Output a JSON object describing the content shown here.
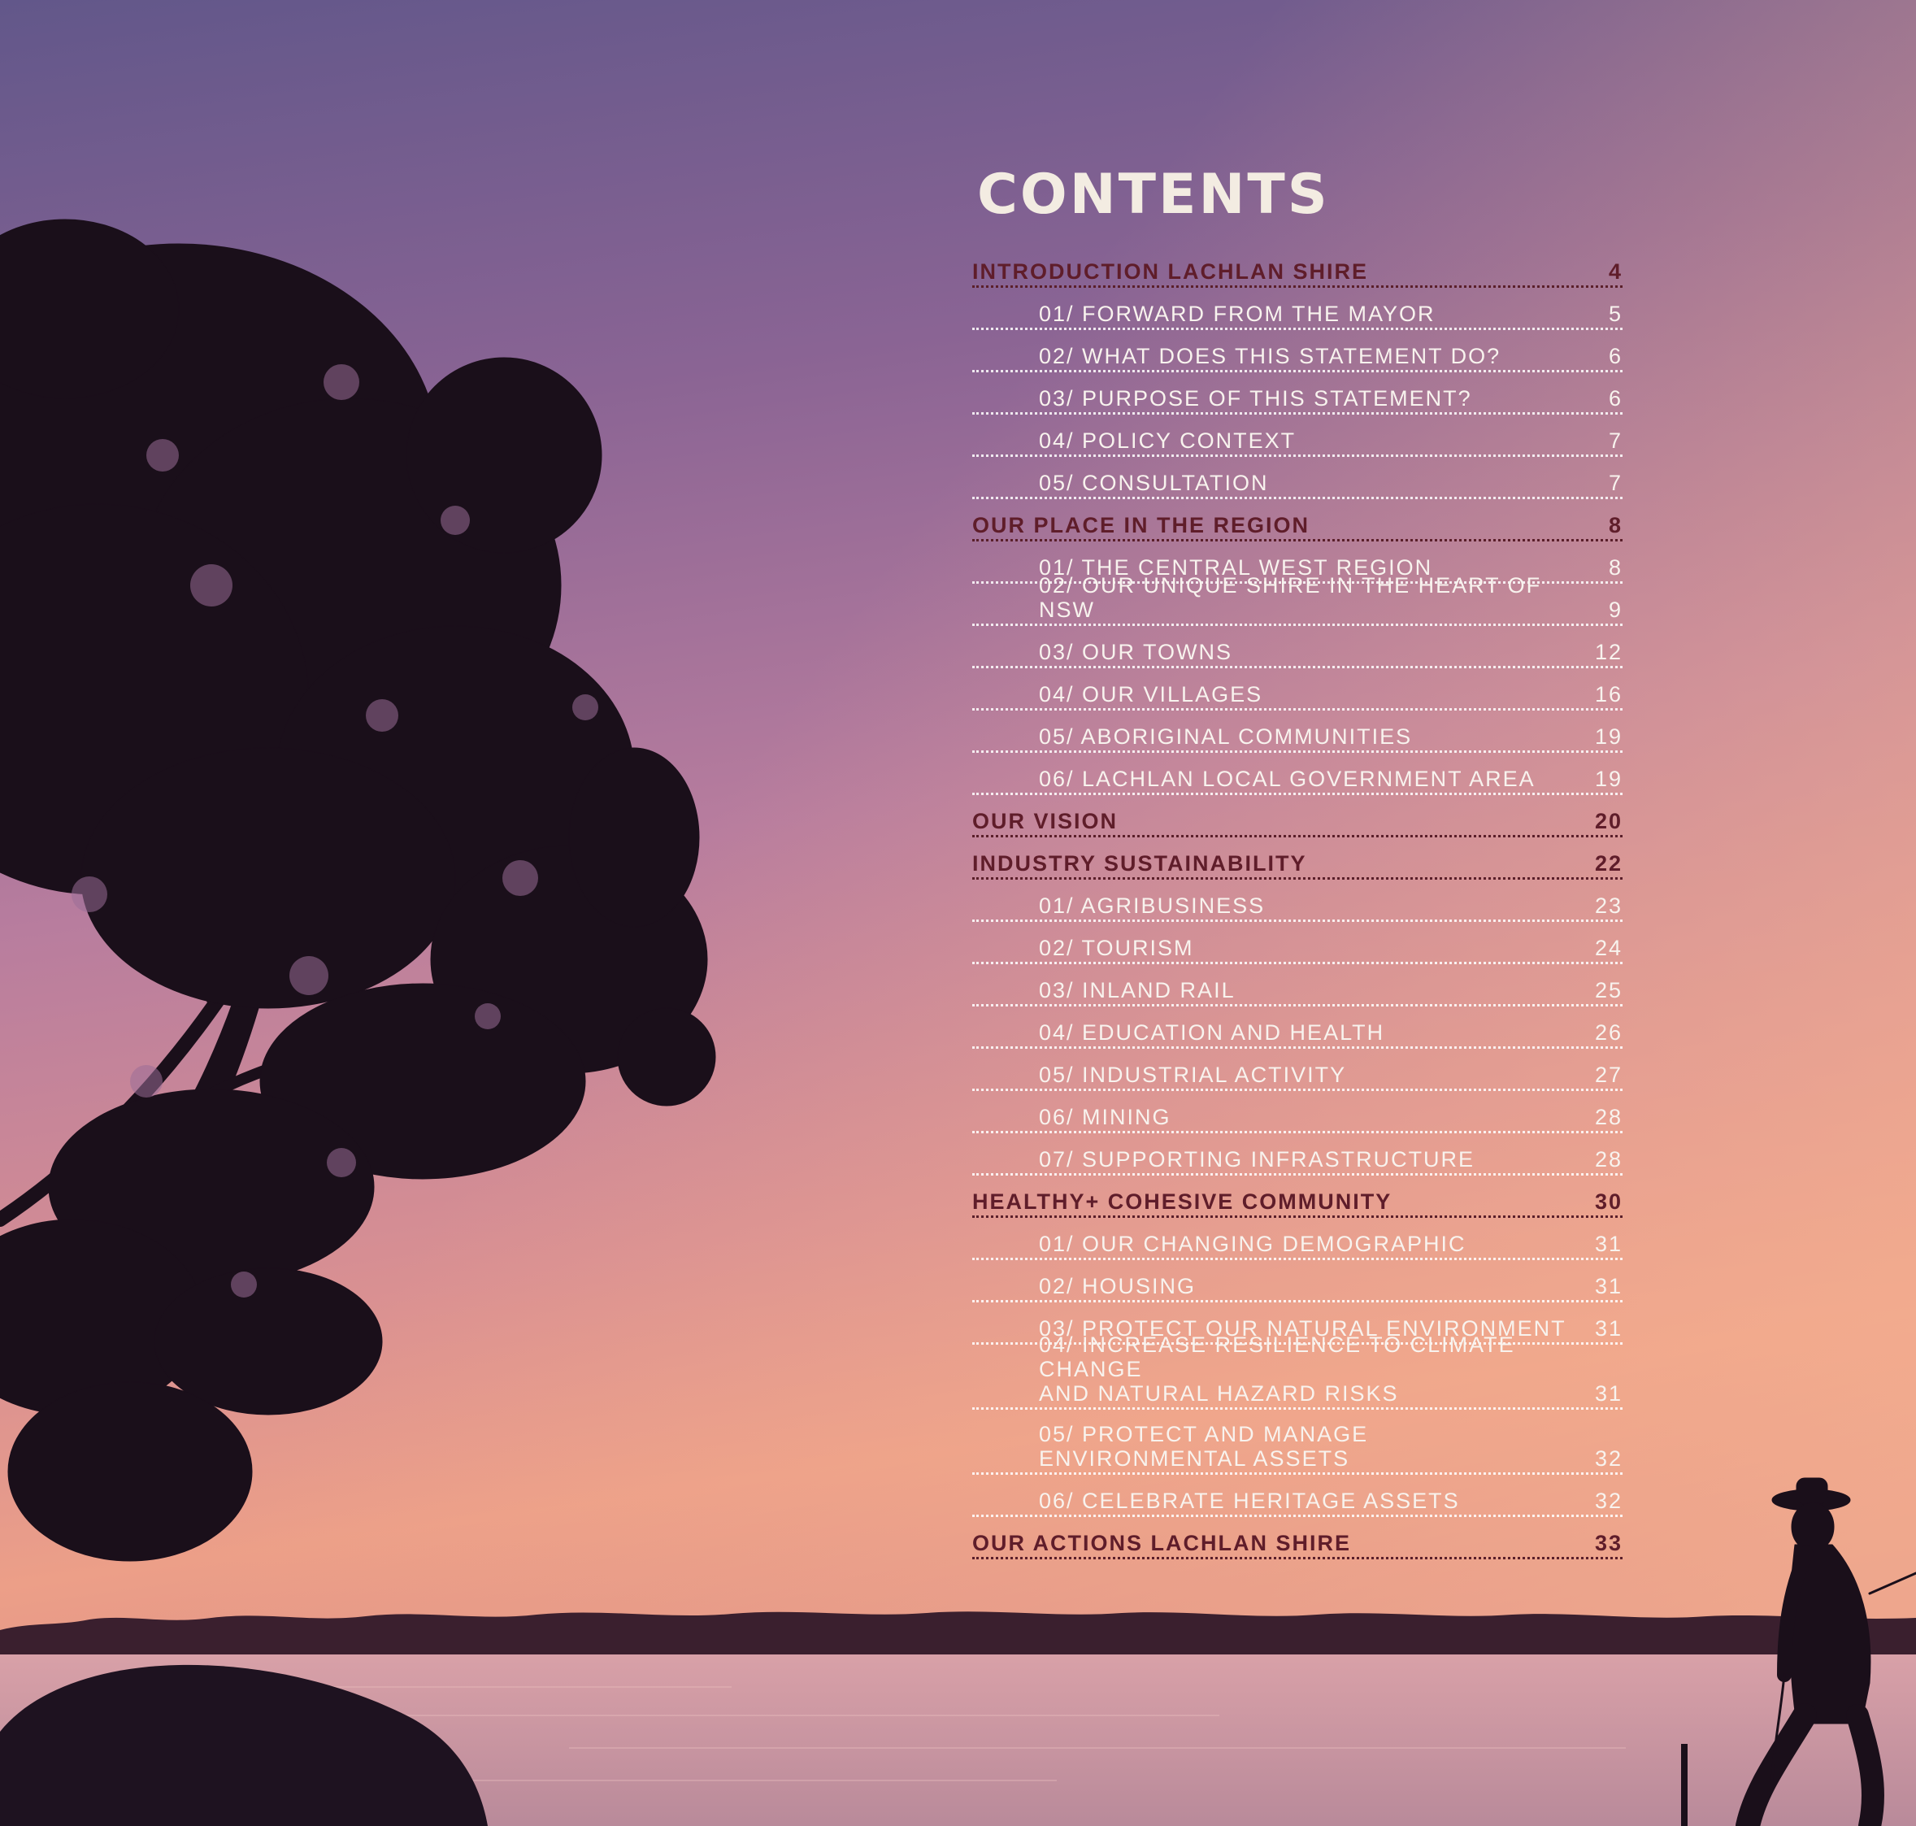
{
  "title": "CONTENTS",
  "entries": [
    {
      "type": "section",
      "label": "INTRODUCTION LACHLAN SHIRE",
      "page": "4"
    },
    {
      "type": "sub",
      "label": "01/ FORWARD FROM THE MAYOR",
      "page": "5"
    },
    {
      "type": "sub",
      "label": "02/ WHAT DOES THIS STATEMENT DO?",
      "page": "6"
    },
    {
      "type": "sub",
      "label": "03/ PURPOSE OF THIS STATEMENT?",
      "page": "6"
    },
    {
      "type": "sub",
      "label": "04/ POLICY CONTEXT",
      "page": "7"
    },
    {
      "type": "sub",
      "label": "05/ CONSULTATION",
      "page": "7"
    },
    {
      "type": "section",
      "label": "OUR PLACE IN THE REGION",
      "page": "8"
    },
    {
      "type": "sub",
      "label": "01/ THE CENTRAL WEST REGION",
      "page": "8"
    },
    {
      "type": "sub",
      "label": "02/ OUR UNIQUE SHIRE IN THE HEART OF NSW",
      "page": "9"
    },
    {
      "type": "sub",
      "label": "03/ OUR TOWNS",
      "page": "12"
    },
    {
      "type": "sub",
      "label": "04/ OUR VILLAGES",
      "page": "16"
    },
    {
      "type": "sub",
      "label": "05/ ABORIGINAL COMMUNITIES",
      "page": "19"
    },
    {
      "type": "sub",
      "label": "06/ LACHLAN LOCAL GOVERNMENT AREA",
      "page": "19"
    },
    {
      "type": "section",
      "label": "OUR VISION",
      "page": "20"
    },
    {
      "type": "section",
      "label": "INDUSTRY SUSTAINABILITY",
      "page": "22"
    },
    {
      "type": "sub",
      "label": "01/ AGRIBUSINESS",
      "page": "23"
    },
    {
      "type": "sub",
      "label": "02/ TOURISM",
      "page": "24"
    },
    {
      "type": "sub",
      "label": "03/ INLAND RAIL",
      "page": "25"
    },
    {
      "type": "sub",
      "label": "04/ EDUCATION AND HEALTH",
      "page": "26"
    },
    {
      "type": "sub",
      "label": "05/ INDUSTRIAL ACTIVITY",
      "page": "27"
    },
    {
      "type": "sub",
      "label": "06/ MINING",
      "page": "28"
    },
    {
      "type": "sub",
      "label": "07/  SUPPORTING INFRASTRUCTURE",
      "page": "28"
    },
    {
      "type": "section",
      "label": "HEALTHY+ COHESIVE COMMUNITY",
      "page": "30"
    },
    {
      "type": "sub",
      "label": "01/ OUR CHANGING DEMOGRAPHIC",
      "page": "31"
    },
    {
      "type": "sub",
      "label": "02/ HOUSING",
      "page": "31"
    },
    {
      "type": "sub",
      "label": "03/ PROTECT OUR NATURAL ENVIRONMENT",
      "page": "31"
    },
    {
      "type": "sub",
      "label": "04/ INCREASE RESILIENCE TO CLIMATE CHANGE\nAND NATURAL HAZARD RISKS",
      "page": "31",
      "tall": true
    },
    {
      "type": "sub",
      "label": "05/ PROTECT AND MANAGE\nENVIRONMENTAL ASSETS",
      "page": "32",
      "tall": true
    },
    {
      "type": "sub",
      "label": "06/ CELEBRATE HERITAGE ASSETS",
      "page": "32"
    },
    {
      "type": "section",
      "label": "OUR ACTIONS LACHLAN SHIRE",
      "page": "33"
    }
  ],
  "colors": {
    "sky_top": "#6a5a8a",
    "sky_mid": "#b77d9a",
    "sky_low": "#e8a08e",
    "section_text": "#5f1d2a",
    "sub_text": "#f8f3ee",
    "title_text": "#f3ece2",
    "silhouette": "#1a0f1a"
  }
}
